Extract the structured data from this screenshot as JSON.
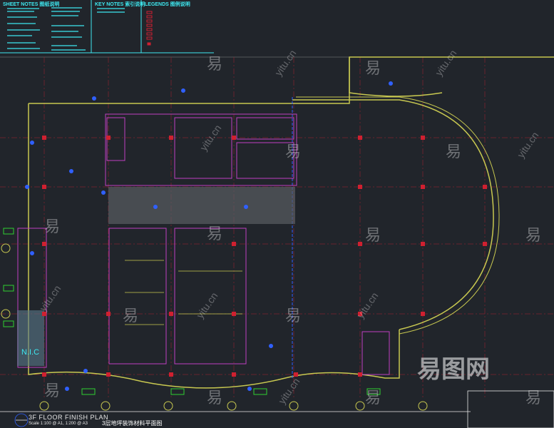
{
  "header": {
    "sheet_notes": "SHEET NOTES 图纸说明",
    "key_notes": "KEY NOTES 索引说明",
    "legends": "LEGENDS 图例说明"
  },
  "plan": {
    "title": "3F FLOOR FINISH PLAN",
    "scale": "Scale 1:100 @ A1, 1:200 @ A3",
    "title_cn": "3层地坪装饰材料平面图",
    "nic_label": "N.I.C"
  },
  "watermark": {
    "glyph": "易",
    "site": "yitu.cn",
    "logo": "易图网"
  },
  "colors": {
    "background": "#21252b",
    "cyan": "#3ee8f0",
    "red": "#d02030",
    "yellow": "#c8c850",
    "magenta": "#c040c0",
    "blue": "#3060ff",
    "green": "#30d030"
  }
}
